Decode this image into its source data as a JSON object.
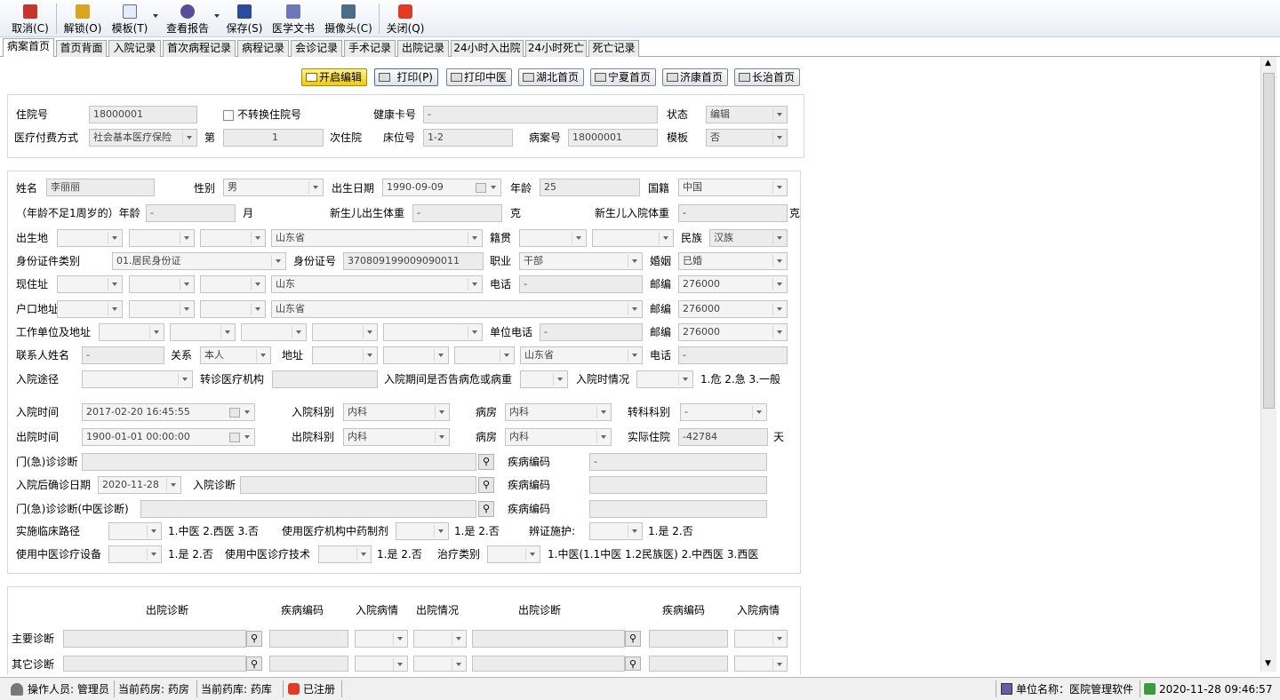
{
  "toolbar": {
    "cancel": "取消(C)",
    "unlock": "解锁(O)",
    "template": "模板(T)",
    "view_report": "查看报告",
    "save": "保存(S)",
    "med_doc": "医学文书",
    "camera": "摄像头(C)",
    "close": "关闭(Q)"
  },
  "tabs": [
    "病案首页",
    "首页背面",
    "入院记录",
    "首次病程记录",
    "病程记录",
    "会诊记录",
    "手术记录",
    "出院记录",
    "24小时入出院",
    "24小时死亡",
    "死亡记录"
  ],
  "actions": {
    "edit": "开启编辑",
    "print": "打印(P)",
    "print_tcm": "打印中医",
    "hubei": "湖北首页",
    "ningxia": "宁夏首页",
    "jikang": "济康首页",
    "changzhi": "长治首页"
  },
  "header": {
    "admission_no_label": "住院号",
    "admission_no": "18000001",
    "no_convert_label": "不转换住院号",
    "health_card_label": "健康卡号",
    "health_card": "-",
    "status_label": "状态",
    "status": "编辑",
    "payment_label": "医疗付费方式",
    "payment": "社会基本医疗保险",
    "nth_label": "第",
    "nth": "1",
    "times_label": "次住院",
    "bed_label": "床位号",
    "bed": "1-2",
    "record_no_label": "病案号",
    "record_no": "18000001",
    "template_label": "模板",
    "template": "否"
  },
  "patient": {
    "name_label": "姓名",
    "name": "李丽丽",
    "sex_label": "性别",
    "sex": "男",
    "dob_label": "出生日期",
    "dob": "1990-09-09",
    "age_label": "年龄",
    "age": "25",
    "nationality_label": "国籍",
    "nationality": "中国",
    "infant_age_label": "（年龄不足1周岁的）年龄",
    "infant_age": "-",
    "month_unit": "月",
    "birth_weight_label": "新生儿出生体重",
    "birth_weight": "-",
    "gram_unit": "克",
    "admit_weight_label": "新生儿入院体重",
    "admit_weight": "-",
    "gram_unit2": "克",
    "birthplace_label": "出生地",
    "birthplace": "山东省",
    "native_label": "籍贯",
    "ethnic_label": "民族",
    "ethnic": "汉族",
    "id_type_label": "身份证件类别",
    "id_type": "01.居民身份证",
    "id_no_label": "身份证号",
    "id_no": "370809199009090011",
    "job_label": "职业",
    "job": "干部",
    "marital_label": "婚姻",
    "marital": "已婚",
    "current_addr_label": "现住址",
    "current_addr": "山东",
    "phone_label": "电话",
    "phone": "-",
    "zip_label": "邮编",
    "zip1": "276000",
    "household_label": "户口地址",
    "household": "山东省",
    "zip_label2": "邮编",
    "zip2": "276000",
    "work_label": "工作单位及地址",
    "work_phone_label": "单位电话",
    "work_phone": "-",
    "zip_label3": "邮编",
    "zip3": "276000",
    "contact_label": "联系人姓名",
    "contact": "-",
    "relation_label": "关系",
    "relation": "本人",
    "contact_addr_label": "地址",
    "contact_addr": "山东省",
    "contact_phone_label": "电话",
    "contact_phone": "-",
    "admit_route_label": "入院途径",
    "transfer_org_label": "转诊医疗机构",
    "critical_label": "入院期间是否告病危或病重",
    "admit_cond_label": "入院时情况",
    "admit_cond_hint": "1.危 2.急 3.一般"
  },
  "visit": {
    "admit_time_label": "入院时间",
    "admit_time": "2017-02-20 16:45:55",
    "admit_dept_label": "入院科别",
    "admit_dept": "内科",
    "ward_label": "病房",
    "ward1": "内科",
    "transfer_label": "转科科别",
    "transfer": "-",
    "discharge_time_label": "出院时间",
    "discharge_time": "1900-01-01 00:00:00",
    "discharge_dept_label": "出院科别",
    "discharge_dept": "内科",
    "ward_label2": "病房",
    "ward2": "内科",
    "days_label": "实际住院",
    "days": "-42784",
    "days_unit": "天",
    "outpatient_label": "门(急)诊诊断",
    "code_label1": "疾病编码",
    "code1": "-",
    "confirm_date_label": "入院后确诊日期",
    "confirm_date": "2020-11-28",
    "admit_diag_label": "入院诊断",
    "code_label2": "疾病编码",
    "tcm_diag_label": "门(急)诊诊断(中医诊断)",
    "code_label3": "疾病编码",
    "pathway_label": "实施临床路径",
    "pathway_hint": "1.中医 2.西医 3.否",
    "prep_label": "使用医疗机构中药制剂",
    "prep_hint": "1.是 2.否",
    "nursing_label": "辨证施护:",
    "nursing_hint": "1.是 2.否",
    "equip_label": "使用中医诊疗设备",
    "equip_hint": "1.是 2.否",
    "tech_label": "使用中医诊疗技术",
    "tech_hint": "1.是 2.否",
    "treat_label": "治疗类别",
    "treat_hint": "1.中医(1.1中医 1.2民族医) 2.中西医 3.西医"
  },
  "diag": {
    "h1": "出院诊断",
    "h2": "疾病编码",
    "h3": "入院病情",
    "h4": "出院情况",
    "h5": "出院诊断",
    "h6": "疾病编码",
    "h7": "入院病情",
    "main_label": "主要诊断",
    "other_label": "其它诊断"
  },
  "status": {
    "operator": "操作人员: 管理员",
    "pharmacy": "当前药房: 药房",
    "store": "当前药库: 药库",
    "registered": "已注册",
    "unit": "单位名称：医院管理软件",
    "datetime": "2020-11-28 09:46:57"
  }
}
